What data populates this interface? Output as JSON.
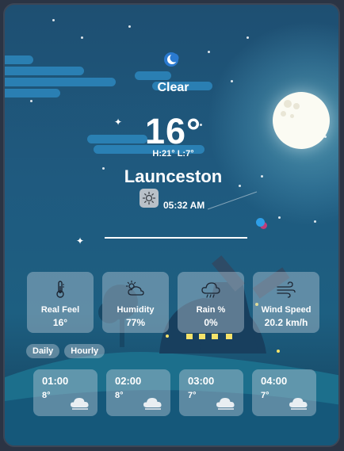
{
  "current": {
    "condition": "Clear",
    "temperature": "16°",
    "hi_lo": "H:21° L:7°",
    "city": "Launceston",
    "time": "05:32 AM"
  },
  "details": [
    {
      "icon": "thermometer-icon",
      "label": "Real Feel",
      "value": "16°"
    },
    {
      "icon": "humidity-icon",
      "label": "Humidity",
      "value": "77%"
    },
    {
      "icon": "rain-cloud-icon",
      "label": "Rain %",
      "value": "0%"
    },
    {
      "icon": "wind-icon",
      "label": "Wind Speed",
      "value": "20.2 km/h"
    }
  ],
  "tabs": [
    {
      "label": "Daily"
    },
    {
      "label": "Hourly"
    }
  ],
  "hourly": [
    {
      "time": "01:00",
      "temp": "8°",
      "icon": "cloud-icon"
    },
    {
      "time": "02:00",
      "temp": "8°",
      "icon": "cloud-icon"
    },
    {
      "time": "03:00",
      "temp": "7°",
      "icon": "cloud-icon"
    },
    {
      "time": "04:00",
      "temp": "7°",
      "icon": "cloud-icon"
    }
  ],
  "colors": {
    "sky_top": "#1e4f72",
    "sky_bottom": "#143f5a",
    "card_bg": "#bfcdda",
    "cloud_bar": "#2d87bd",
    "moon": "#fbfbf3",
    "window_light": "#f6e36a"
  }
}
